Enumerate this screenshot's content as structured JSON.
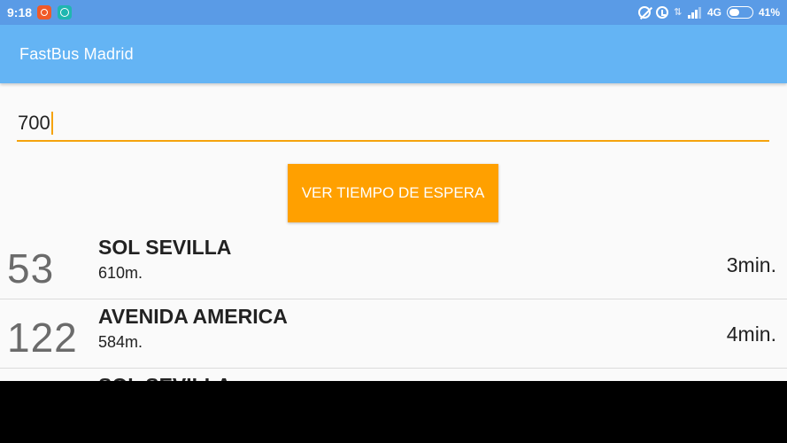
{
  "status_bar": {
    "time": "9:18",
    "network": "4G",
    "battery": "41%",
    "battery_level": 0.41
  },
  "app": {
    "title": "FastBus Madrid"
  },
  "search": {
    "value": "700"
  },
  "action_button": {
    "label": "VER TIEMPO DE ESPERA"
  },
  "arrivals": [
    {
      "line": "53",
      "stop": "SOL SEVILLA",
      "distance": "610m.",
      "eta": "3min."
    },
    {
      "line": "122",
      "stop": "AVENIDA AMERICA",
      "distance": "584m.",
      "eta": "4min."
    },
    {
      "line": "",
      "stop": "SOL SEVILLA",
      "distance": "",
      "eta": ""
    }
  ],
  "colors": {
    "status_bar": "#5a9be6",
    "app_bar": "#64b4f4",
    "accent": "#ffa000",
    "input_underline": "#f5a30d"
  }
}
